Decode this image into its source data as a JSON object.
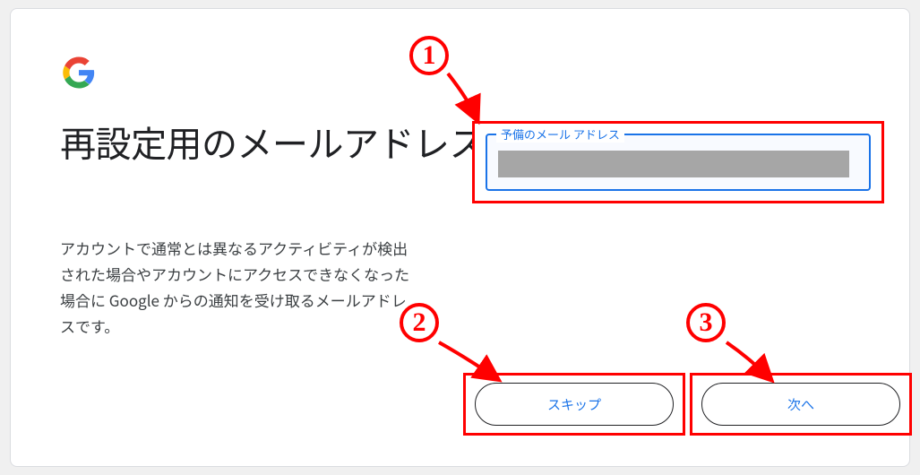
{
  "heading": "再設定用のメールアドレスを追加",
  "description": "アカウントで通常とは異なるアクティビティが検出された場合やアカウントにアクセスできなくなった場合に Google からの通知を受け取るメールアドレスです。",
  "input": {
    "label": "予備のメール アドレス"
  },
  "actions": {
    "skip": "スキップ",
    "next": "次へ"
  },
  "annotations": {
    "a1": "1",
    "a2": "2",
    "a3": "3"
  }
}
